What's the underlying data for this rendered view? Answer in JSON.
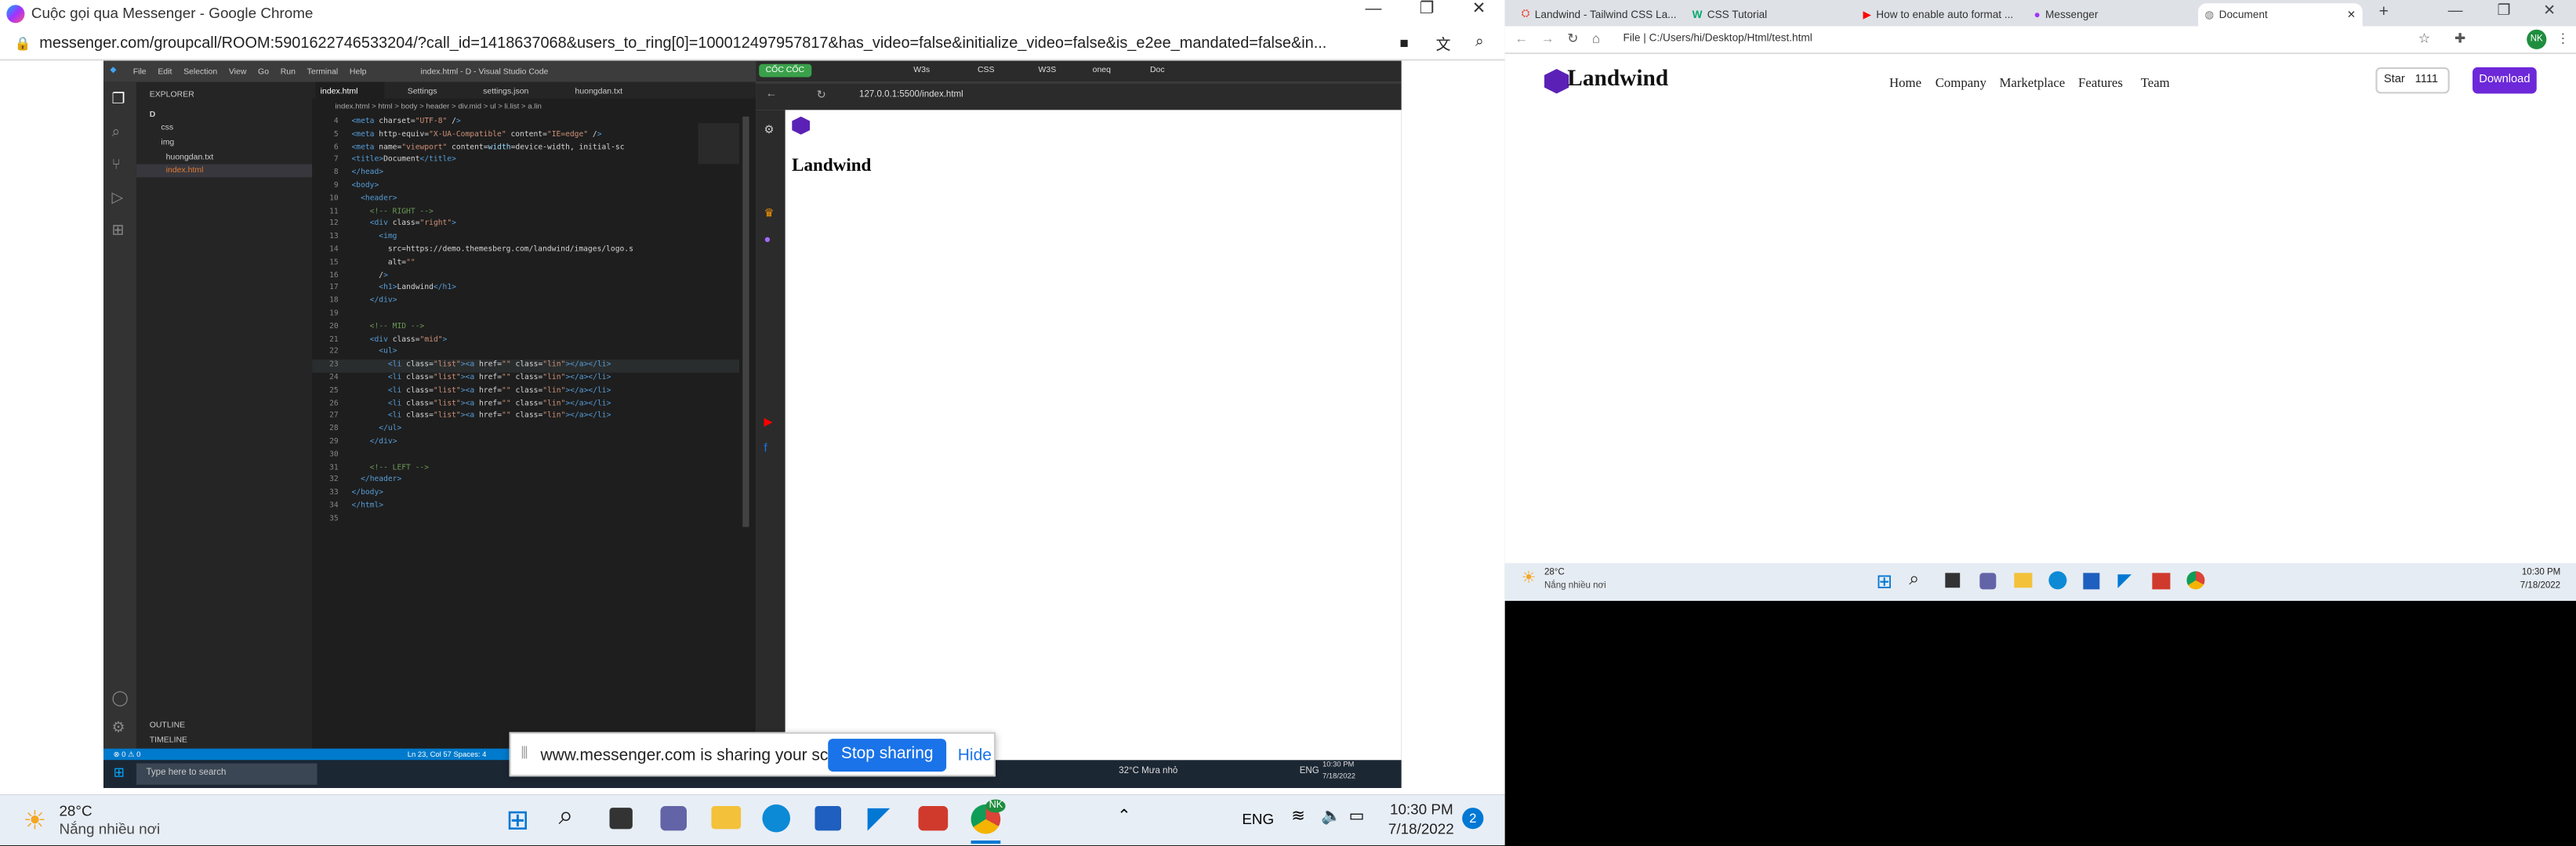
{
  "left_window": {
    "title": "Cuộc gọi qua Messenger - Google Chrome",
    "address": "messenger.com/groupcall/ROOM:5901622746533204/?call_id=1418637068&users_to_ring[0]=100012497957817&has_video=false&initialize_video=false&is_e2ee_mandated=false&in..."
  },
  "vscode": {
    "menu": [
      "File",
      "Edit",
      "Selection",
      "View",
      "Go",
      "Run",
      "Terminal",
      "Help"
    ],
    "title": "index.html - D - Visual Studio Code",
    "tabs": [
      "index.html",
      "Settings",
      "settings.json",
      "huongdan.txt"
    ],
    "breadcrumb": "index.html > html > body > header > div.mid > ul > li.list > a.lin",
    "explorer_label": "EXPLORER",
    "tree": [
      "D",
      "css",
      "img",
      "huongdan.txt",
      "index.html"
    ],
    "outline": "OUTLINE",
    "timeline": "TIMELINE",
    "status_left": "⊗ 0 ⚠ 0",
    "status_right": "Ln 23, Col 57   Spaces: 4",
    "lines": [
      {
        "n": "4",
        "t": "<meta charset=\"UTF-8\" />"
      },
      {
        "n": "5",
        "t": "<meta http-equiv=\"X-UA-Compatible\" content=\"IE=edge\" />"
      },
      {
        "n": "6",
        "t": "<meta name=\"viewport\" content=\"width=device-width, initial-sc"
      },
      {
        "n": "7",
        "t": "<title>Document</title>"
      },
      {
        "n": "8",
        "t": "</head>"
      },
      {
        "n": "9",
        "t": "<body>"
      },
      {
        "n": "10",
        "t": "  <header>"
      },
      {
        "n": "11",
        "t": "    <!-- RIGHT -->"
      },
      {
        "n": "12",
        "t": "    <div class=\"right\">"
      },
      {
        "n": "13",
        "t": "      <img"
      },
      {
        "n": "14",
        "t": "        src=\"https://demo.themesberg.com/landwind/images/logo.s"
      },
      {
        "n": "15",
        "t": "        alt=\"\""
      },
      {
        "n": "16",
        "t": "      />"
      },
      {
        "n": "17",
        "t": "      <h1>Landwind</h1>"
      },
      {
        "n": "18",
        "t": "    </div>"
      },
      {
        "n": "19",
        "t": ""
      },
      {
        "n": "20",
        "t": "    <!-- MID -->"
      },
      {
        "n": "21",
        "t": "    <div class=\"mid\">"
      },
      {
        "n": "22",
        "t": "      <ul>"
      },
      {
        "n": "23",
        "t": "        <li class=\"list\"><a href=\"\" class=\"lin\"></a></li>"
      },
      {
        "n": "24",
        "t": "        <li class=\"list\"><a href=\"\" class=\"lin\"></a></li>"
      },
      {
        "n": "25",
        "t": "        <li class=\"list\"><a href=\"\" class=\"lin\"></a></li>"
      },
      {
        "n": "26",
        "t": "        <li class=\"list\"><a href=\"\" class=\"lin\"></a></li>"
      },
      {
        "n": "27",
        "t": "        <li class=\"list\"><a href=\"\" class=\"lin\"></a></li>"
      },
      {
        "n": "28",
        "t": "      </ul>"
      },
      {
        "n": "29",
        "t": "    </div>"
      },
      {
        "n": "30",
        "t": ""
      },
      {
        "n": "31",
        "t": "    <!-- LEFT -->"
      },
      {
        "n": "32",
        "t": "  </header>"
      },
      {
        "n": "33",
        "t": "</body>"
      },
      {
        "n": "34",
        "t": "</html>"
      },
      {
        "n": "35",
        "t": ""
      }
    ]
  },
  "inner_chrome": {
    "tabs": [
      "CỐC CỐC",
      "W3s",
      "CSS",
      "W3S",
      "oneq",
      "Doc"
    ],
    "address": "127.0.0.1:5500/index.html",
    "heading": "Landwind"
  },
  "inner_taskbar": {
    "search": "Type here to search",
    "weather": "32°C  Mưa nhỏ",
    "lang": "ENG",
    "time": "10:30 PM",
    "date": "7/18/2022"
  },
  "share_bar": {
    "text": "www.messenger.com is sharing your screen.",
    "stop": "Stop sharing",
    "hide": "Hide"
  },
  "taskbar": {
    "temp": "28°C",
    "cond": "Nắng nhiều nơi",
    "lang": "ENG",
    "time": "10:30 PM",
    "date": "7/18/2022",
    "badge": "2",
    "chrome_badge": "NK"
  },
  "right_window": {
    "tabs": [
      "Landwind - Tailwind CSS La...",
      "CSS Tutorial",
      "How to enable auto format ...",
      "Messenger",
      "Document"
    ],
    "address": "File  |  C:/Users/hi/Desktop/Html/test.html",
    "brand": "Landwind",
    "nav": [
      "Home",
      "Company",
      "Marketplace",
      "Features",
      "Team"
    ],
    "star": "Star",
    "star_count": "1111",
    "download": "Download",
    "task_temp": "28°C",
    "task_cond": "Nắng nhiều nơi",
    "task_time": "10:30 PM",
    "task_date": "7/18/2022"
  },
  "colors": {
    "accent": "#5b21b6",
    "vsblue": "#007acc",
    "stop": "#1a73e8"
  }
}
